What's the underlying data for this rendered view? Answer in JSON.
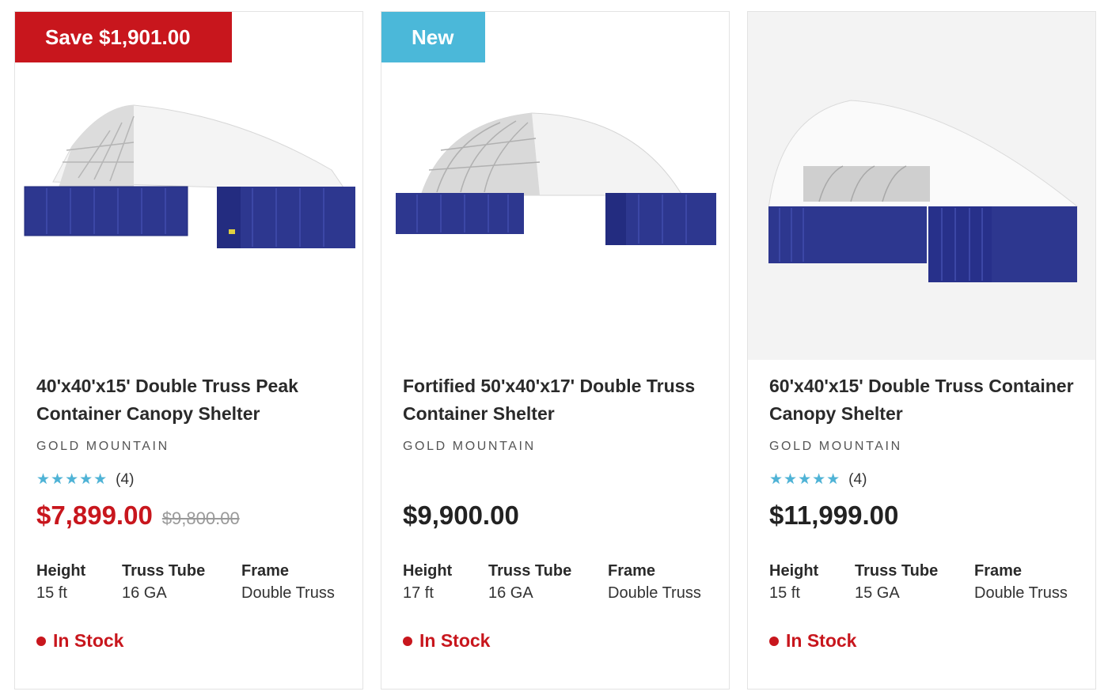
{
  "products": [
    {
      "badge": "Save $1,901.00",
      "title": "40'x40'x15' Double Truss Peak Container Canopy Shelter",
      "brand": "GOLD MOUNTAIN",
      "stars": "★★★★★",
      "rating_count": "(4)",
      "price": "$7,899.00",
      "compare_price": "$9,800.00",
      "specs": [
        {
          "label": "Height",
          "value": "15 ft"
        },
        {
          "label": "Truss Tube",
          "value": "16 GA"
        },
        {
          "label": "Frame",
          "value": "Double Truss"
        }
      ],
      "stock": "In Stock"
    },
    {
      "badge": "New",
      "title": "Fortified 50'x40'x17' Double Truss Container Shelter",
      "brand": "GOLD MOUNTAIN",
      "price": "$9,900.00",
      "specs": [
        {
          "label": "Height",
          "value": "17 ft"
        },
        {
          "label": "Truss Tube",
          "value": "16 GA"
        },
        {
          "label": "Frame",
          "value": "Double Truss"
        }
      ],
      "stock": "In Stock"
    },
    {
      "title": "60'x40'x15' Double Truss Container Canopy Shelter",
      "brand": "GOLD MOUNTAIN",
      "stars": "★★★★★",
      "rating_count": "(4)",
      "price": "$11,999.00",
      "specs": [
        {
          "label": "Height",
          "value": "15 ft"
        },
        {
          "label": "Truss Tube",
          "value": "15 GA"
        },
        {
          "label": "Frame",
          "value": "Double Truss"
        }
      ],
      "stock": "In Stock"
    }
  ],
  "colors": {
    "sale_red": "#c8161d",
    "new_blue": "#4bb8d9",
    "star_blue": "#4fb3d6",
    "container_blue": "#2c3590"
  }
}
